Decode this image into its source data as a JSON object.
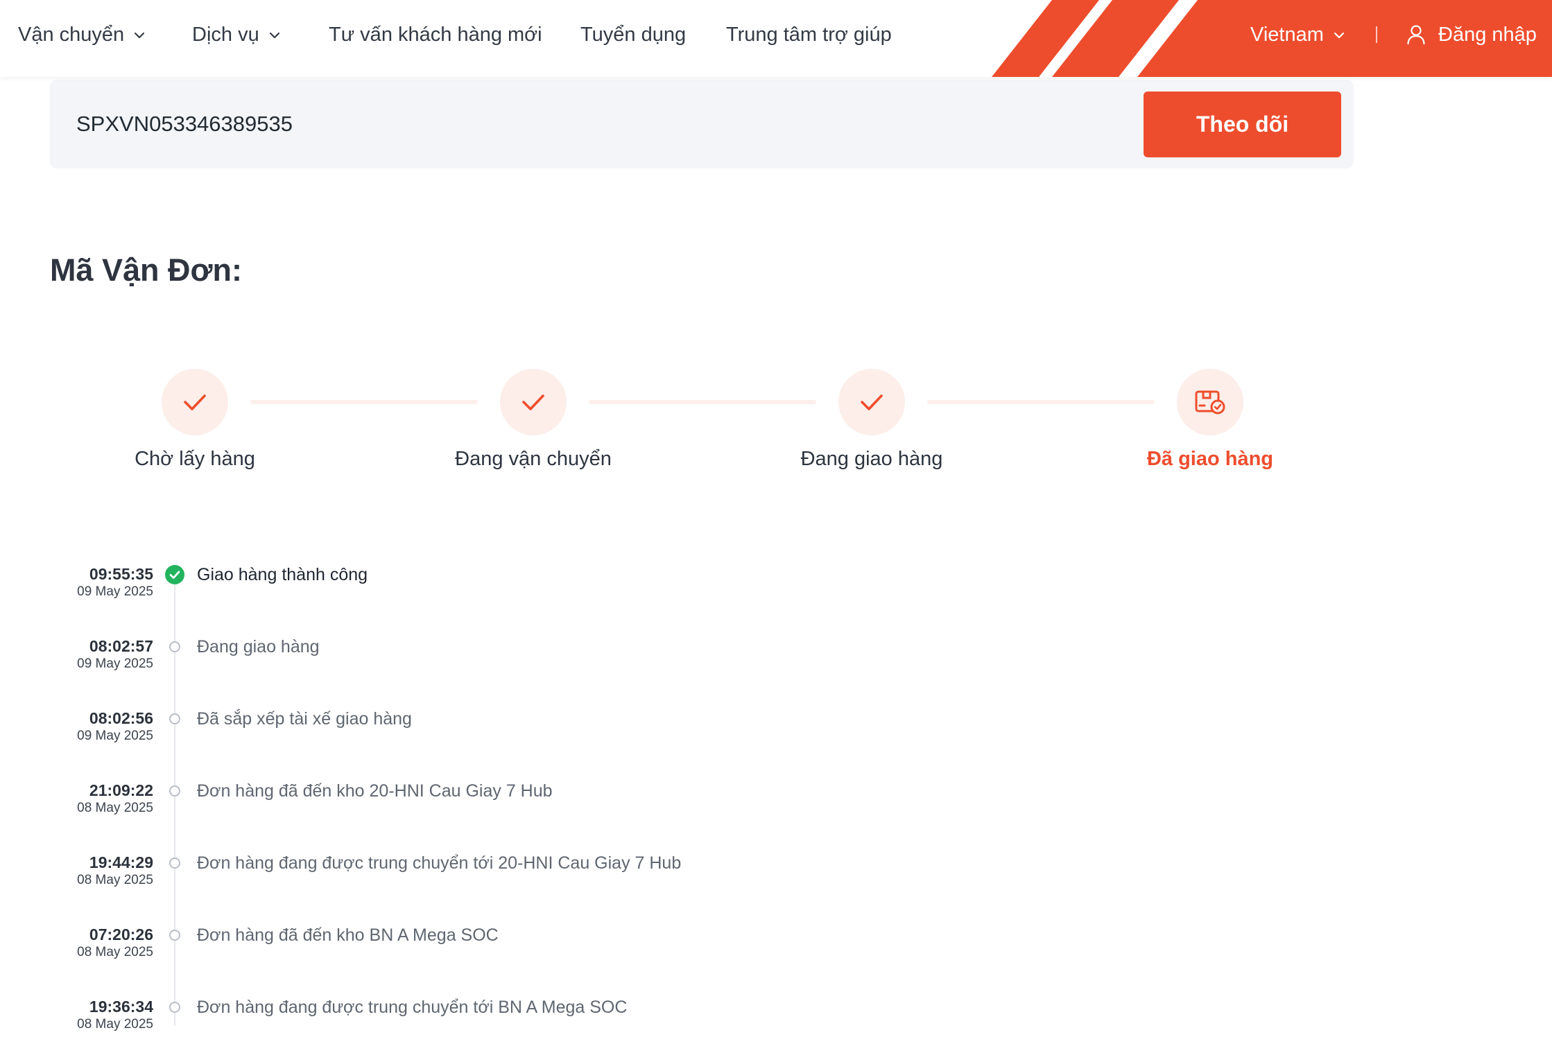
{
  "header": {
    "nav": [
      {
        "label": "Vận chuyển",
        "dropdown": true
      },
      {
        "label": "Dịch vụ",
        "dropdown": true
      },
      {
        "label": "Tư vấn khách hàng mới",
        "dropdown": false
      },
      {
        "label": "Tuyển dụng",
        "dropdown": false
      },
      {
        "label": "Trung tâm trợ giúp",
        "dropdown": false
      }
    ],
    "country": "Vietnam",
    "login": "Đăng nhập"
  },
  "search": {
    "value": "SPXVN053346389535",
    "button": "Theo dõi"
  },
  "title": "Mã Vận Đơn:",
  "steps": [
    {
      "label": "Chờ lấy hàng",
      "state": "done",
      "icon": "check-icon"
    },
    {
      "label": "Đang vận chuyển",
      "state": "done",
      "icon": "check-icon"
    },
    {
      "label": "Đang giao hàng",
      "state": "done",
      "icon": "check-icon"
    },
    {
      "label": "Đã giao hàng",
      "state": "current",
      "icon": "delivered-box-icon"
    }
  ],
  "timeline": [
    {
      "time": "09:55:35",
      "date": "09 May 2025",
      "text": "Giao hàng thành công",
      "status": "done"
    },
    {
      "time": "08:02:57",
      "date": "09 May 2025",
      "text": "Đang giao hàng",
      "status": "past"
    },
    {
      "time": "08:02:56",
      "date": "09 May 2025",
      "text": "Đã sắp xếp tài xế giao hàng",
      "status": "past"
    },
    {
      "time": "21:09:22",
      "date": "08 May 2025",
      "text": "Đơn hàng đã đến kho 20-HNI Cau Giay 7 Hub",
      "status": "past"
    },
    {
      "time": "19:44:29",
      "date": "08 May 2025",
      "text": "Đơn hàng đang được trung chuyển tới 20-HNI Cau Giay 7 Hub",
      "status": "past"
    },
    {
      "time": "07:20:26",
      "date": "08 May 2025",
      "text": "Đơn hàng đã đến kho BN A Mega SOC",
      "status": "past"
    },
    {
      "time": "19:36:34",
      "date": "08 May 2025",
      "text": "Đơn hàng đang được trung chuyển tới BN A Mega SOC",
      "status": "past"
    }
  ],
  "colors": {
    "brand": "#ee4d2d",
    "brand_soft": "#fdeee9",
    "success": "#22b35e"
  }
}
